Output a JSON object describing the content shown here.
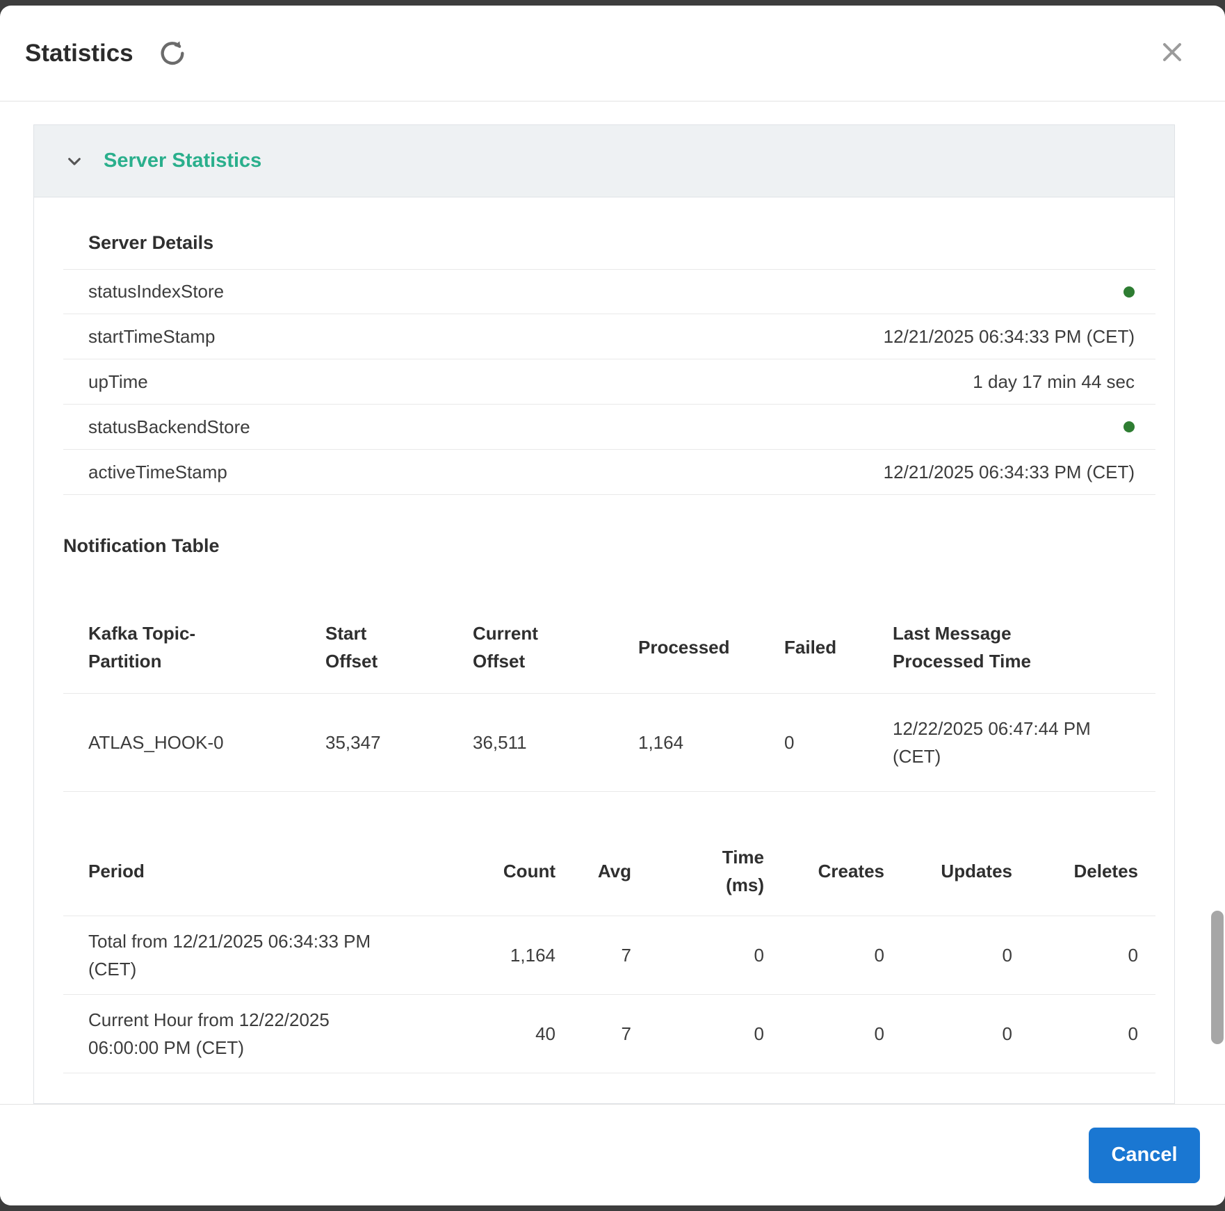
{
  "modal": {
    "title": "Statistics",
    "footer": {
      "cancel_label": "Cancel"
    }
  },
  "section": {
    "title": "Server Statistics"
  },
  "server_details": {
    "heading": "Server Details",
    "rows": [
      {
        "key": "statusIndexStore",
        "value": "",
        "status": "up"
      },
      {
        "key": "startTimeStamp",
        "value": "12/21/2025 06:34:33 PM (CET)"
      },
      {
        "key": "upTime",
        "value": "1 day 17 min 44 sec"
      },
      {
        "key": "statusBackendStore",
        "value": "",
        "status": "up"
      },
      {
        "key": "activeTimeStamp",
        "value": "12/21/2025 06:34:33 PM (CET)"
      }
    ]
  },
  "notification": {
    "heading": "Notification Table",
    "kafka_table": {
      "headers": [
        "Kafka Topic-Partition",
        "Start Offset",
        "Current Offset",
        "Processed",
        "Failed",
        "Last Message Processed Time"
      ],
      "rows": [
        [
          "ATLAS_HOOK-0",
          "35,347",
          "36,511",
          "1,164",
          "0",
          "12/22/2025 06:47:44 PM (CET)"
        ]
      ]
    },
    "period_table": {
      "headers": [
        "Period",
        "Count",
        "Avg",
        "Time (ms)",
        "Creates",
        "Updates",
        "Deletes"
      ],
      "rows": [
        [
          "Total from 12/21/2025 06:34:33 PM (CET)",
          "1,164",
          "7",
          "0",
          "0",
          "0",
          "0"
        ],
        [
          "Current Hour from 12/22/2025 06:00:00 PM (CET)",
          "40",
          "7",
          "0",
          "0",
          "0",
          "0"
        ]
      ]
    }
  },
  "colors": {
    "accent_teal": "#2aaf8c",
    "primary_blue": "#1a77d2",
    "status_green": "#2e7d32",
    "backdrop": "#3d3d3d",
    "scrollbar_thumb": "#a6a6a6"
  }
}
